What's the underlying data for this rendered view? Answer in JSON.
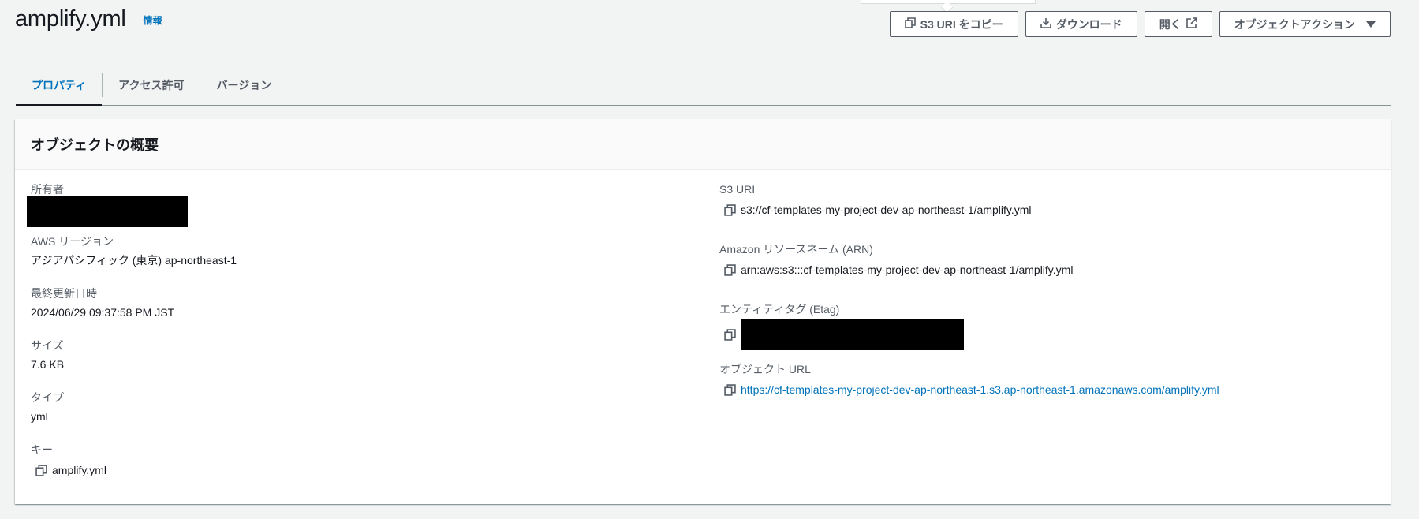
{
  "header": {
    "title": "amplify.yml",
    "info": "情報"
  },
  "actions": {
    "copy_uri": "S3 URI をコピー",
    "download": "ダウンロード",
    "open": "開く",
    "object_actions": "オブジェクトアクション"
  },
  "tabs": [
    "プロパティ",
    "アクセス許可",
    "バージョン"
  ],
  "panel": {
    "title": "オブジェクトの概要",
    "left": {
      "owner_label": "所有者",
      "region_label": "AWS リージョン",
      "region_value": "アジアパシフィック (東京) ap-northeast-1",
      "modified_label": "最終更新日時",
      "modified_value": "2024/06/29 09:37:58 PM JST",
      "size_label": "サイズ",
      "size_value": "7.6 KB",
      "type_label": "タイプ",
      "type_value": "yml",
      "key_label": "キー",
      "key_value": "amplify.yml"
    },
    "right": {
      "s3uri_label": "S3 URI",
      "s3uri_value": "s3://cf-templates-my-project-dev-ap-northeast-1/amplify.yml",
      "arn_label": "Amazon リソースネーム (ARN)",
      "arn_value": "arn:aws:s3:::cf-templates-my-project-dev-ap-northeast-1/amplify.yml",
      "etag_label": "エンティティタグ (Etag)",
      "url_label": "オブジェクト URL",
      "url_value": "https://cf-templates-my-project-dev-ap-northeast-1.s3.ap-northeast-1.amazonaws.com/amplify.yml"
    }
  },
  "colors": {
    "link": "#0073bb",
    "text": "#16191f",
    "muted": "#545b64",
    "background": "#f2f3f3"
  },
  "icons": [
    "copy-icon",
    "download-icon",
    "external-link-icon",
    "caret-down-icon"
  ]
}
